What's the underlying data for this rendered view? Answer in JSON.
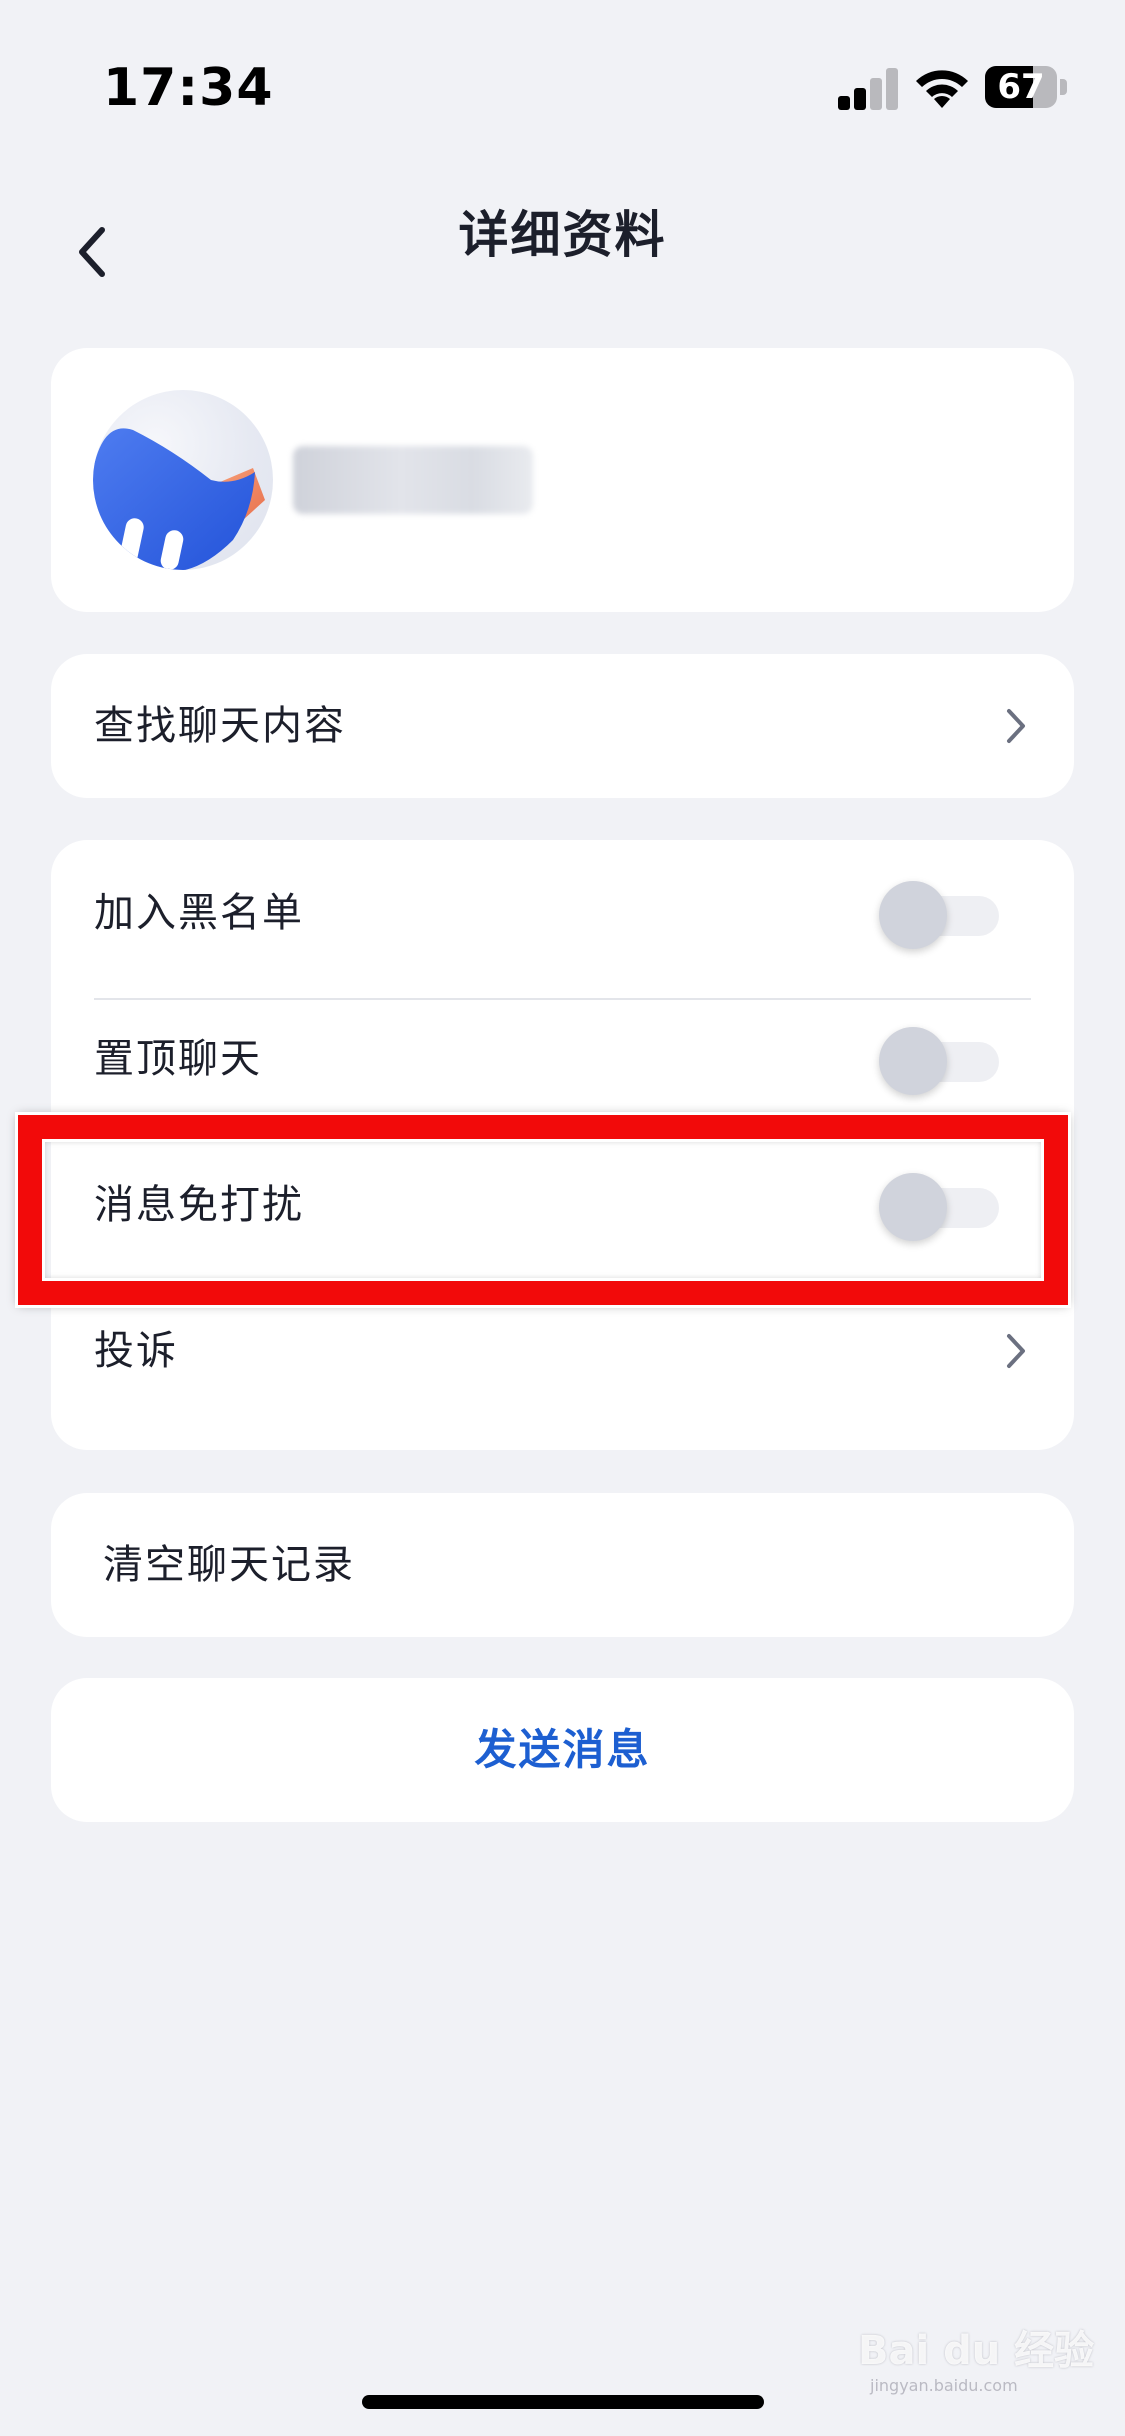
{
  "status_bar": {
    "time": "17:34",
    "battery_level": "67",
    "icons": [
      "signal-icon",
      "wifi-icon",
      "battery-icon"
    ]
  },
  "nav": {
    "title": "详细资料",
    "back_icon": "chevron-left-icon"
  },
  "profile": {
    "avatar_icon": "avatar-image",
    "nickname_blurred": true
  },
  "search": {
    "label": "查找聊天内容",
    "icon": "chevron-right-icon"
  },
  "settings": {
    "blacklist": {
      "label": "加入黑名单",
      "on": false
    },
    "pin_chat": {
      "label": "置顶聊天",
      "on": false
    },
    "mute": {
      "label": "消息免打扰",
      "on": false
    },
    "report": {
      "label": "投诉",
      "icon": "chevron-right-icon"
    }
  },
  "clear_history": {
    "label": "清空聊天记录"
  },
  "send_message": {
    "label": "发送消息"
  },
  "watermark": {
    "text": "Bai du 经验",
    "sub": "jingyan.baidu.com"
  },
  "colors": {
    "background": "#f1f2f6",
    "card": "#ffffff",
    "accent_blue": "#1d5fd1",
    "highlight_red": "#f20a0a",
    "toggle_off_knob": "#d0d3dc"
  }
}
